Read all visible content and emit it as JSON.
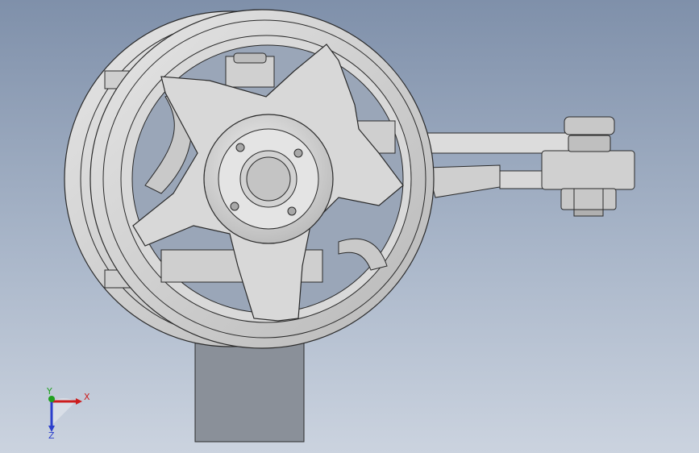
{
  "viewport": {
    "background_top": "#7f90aa",
    "background_bottom": "#cbd3df"
  },
  "model": {
    "part_color": "#d6d6d6",
    "edge_color": "#2a2a2a",
    "mount_color": "#8a9099"
  },
  "triad": {
    "x_label": "X",
    "y_label": "Y",
    "z_label": "Z",
    "x_color": "#cc1d1d",
    "y_color": "#20a020",
    "z_color": "#2b3fcc"
  }
}
